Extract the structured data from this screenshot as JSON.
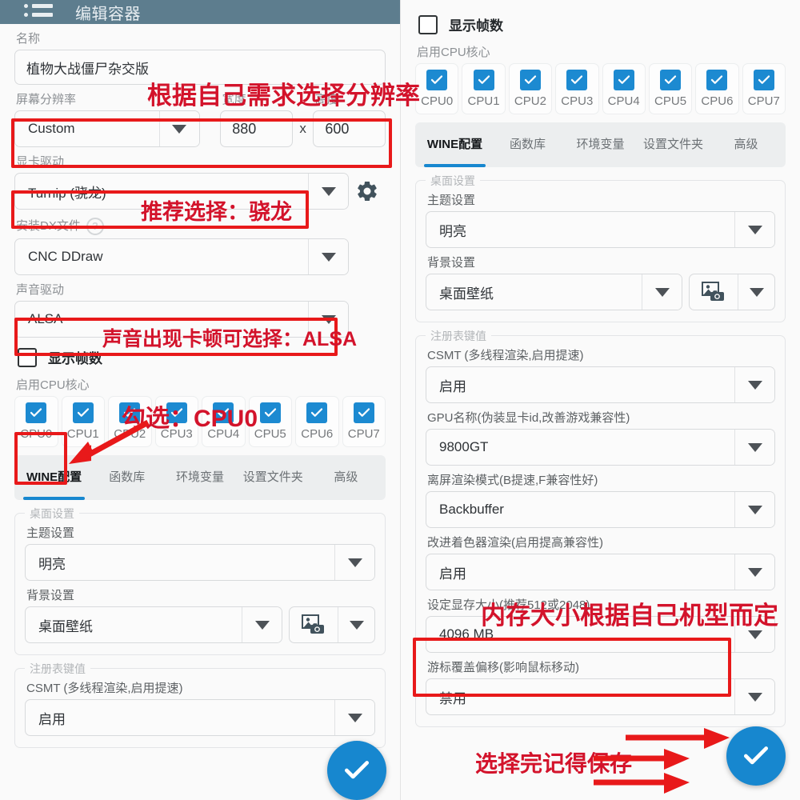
{
  "appbar": {
    "title": "编辑容器",
    "menu_icon": "hamburger-list-icon"
  },
  "left": {
    "name_label": "名称",
    "name_value": "植物大战僵尸杂交版",
    "resolution_label": "屏幕分辨率",
    "resolution_value": "Custom",
    "width_label": "宽度",
    "width_value": "880",
    "x_sep": "x",
    "height_label": "高度",
    "height_value": "600",
    "gpu_driver_label": "显卡驱动",
    "gpu_driver_value": "Turnip (骁龙)",
    "gear_icon": "gear-icon",
    "dx_label": "安装DX文件",
    "dx_help_icon": "help-circle-icon",
    "dx_value": "CNC DDraw",
    "audio_label": "声音驱动",
    "audio_value": "ALSA",
    "show_fps_label": "显示帧数",
    "show_fps_checked": false,
    "cpu_label": "启用CPU核心",
    "cpu_cores": [
      {
        "label": "CPU0",
        "checked": true
      },
      {
        "label": "CPU1",
        "checked": true
      },
      {
        "label": "CPU2",
        "checked": true
      },
      {
        "label": "CPU3",
        "checked": true
      },
      {
        "label": "CPU4",
        "checked": true
      },
      {
        "label": "CPU5",
        "checked": true
      },
      {
        "label": "CPU6",
        "checked": true
      },
      {
        "label": "CPU7",
        "checked": true
      }
    ],
    "tabs": [
      {
        "label": "WINE配置",
        "active": true
      },
      {
        "label": "函数库",
        "active": false
      },
      {
        "label": "环境变量",
        "active": false
      },
      {
        "label": "设置文件夹",
        "active": false
      },
      {
        "label": "高级",
        "active": false
      }
    ],
    "desktop_group_legend": "桌面设置",
    "theme_label": "主题设置",
    "theme_value": "明亮",
    "background_label": "背景设置",
    "background_value": "桌面壁纸",
    "background_image_icon": "image-camera-icon",
    "registry_group_legend": "注册表键值",
    "csmt_label": "CSMT (多线程渲染,启用提速)",
    "csmt_value": "启用"
  },
  "right": {
    "show_fps_label": "显示帧数",
    "show_fps_checked": false,
    "cpu_label": "启用CPU核心",
    "cpu_cores": [
      {
        "label": "CPU0",
        "checked": true
      },
      {
        "label": "CPU1",
        "checked": true
      },
      {
        "label": "CPU2",
        "checked": true
      },
      {
        "label": "CPU3",
        "checked": true
      },
      {
        "label": "CPU4",
        "checked": true
      },
      {
        "label": "CPU5",
        "checked": true
      },
      {
        "label": "CPU6",
        "checked": true
      },
      {
        "label": "CPU7",
        "checked": true
      }
    ],
    "tabs": [
      {
        "label": "WINE配置",
        "active": true
      },
      {
        "label": "函数库",
        "active": false
      },
      {
        "label": "环境变量",
        "active": false
      },
      {
        "label": "设置文件夹",
        "active": false
      },
      {
        "label": "高级",
        "active": false
      }
    ],
    "desktop_group_legend": "桌面设置",
    "theme_label": "主题设置",
    "theme_value": "明亮",
    "background_label": "背景设置",
    "background_value": "桌面壁纸",
    "background_image_icon": "image-camera-icon",
    "registry_group_legend": "注册表键值",
    "csmt_label": "CSMT (多线程渲染,启用提速)",
    "csmt_value": "启用",
    "gpu_name_label": "GPU名称(伪装显卡id,改善游戏兼容性)",
    "gpu_name_value": "9800GT",
    "offscreen_label": "离屏渲染模式(B提速,F兼容性好)",
    "offscreen_value": "Backbuffer",
    "shader_label": "改进着色器渲染(启用提高兼容性)",
    "shader_value": "启用",
    "vram_label": "设定显存大小(推荐512或2048)",
    "vram_value": "4096 MB",
    "cursor_label": "游标覆盖偏移(影响鼠标移动)",
    "cursor_value": "禁用"
  },
  "annotations": {
    "note_resolution": "根据自己需求选择分辨率",
    "note_driver": "推荐选择：骁龙",
    "note_audio": "声音出现卡顿可选择：ALSA",
    "note_cpu": "勾选：CPU0",
    "note_memory": "内存大小根据自己机型而定",
    "note_save": "选择完记得保存",
    "red": "#e8191a",
    "text_red": "#d3132b"
  },
  "fab": {
    "icon": "check-icon",
    "color": "#1787cf"
  }
}
